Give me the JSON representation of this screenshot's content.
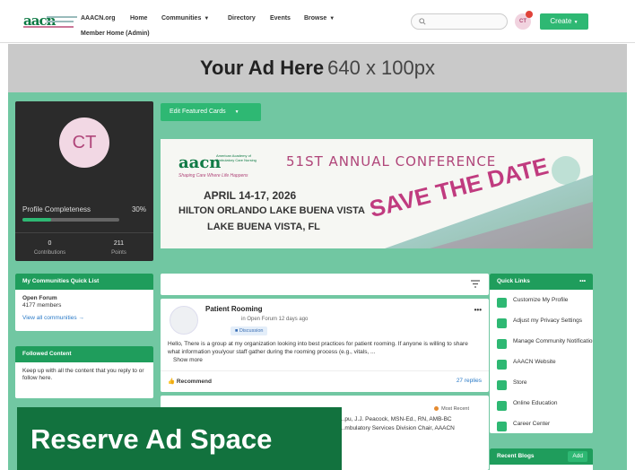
{
  "nav": {
    "logo_text": "aacn",
    "links": [
      "AAACN.org",
      "Home",
      "Communities",
      "Directory",
      "Events",
      "Browse"
    ],
    "second_row_link": "Member Home (Admin)",
    "search_placeholder": "",
    "avatar_initials": "CT",
    "create_label": "Create"
  },
  "ad_banner": {
    "title": "Your Ad Here",
    "size": "640 x 100px"
  },
  "profile": {
    "initials": "CT",
    "completeness_label": "Profile Completeness",
    "completeness_value": "30%",
    "completeness_fraction": 0.3,
    "contributions_count": "0",
    "contributions_label": "Contributions",
    "points_count": "211",
    "points_label": "Points"
  },
  "edit_featured_cards_label": "Edit Featured Cards",
  "conference": {
    "logo_text": "aacn",
    "logo_caption": "American Academy of Ambulatory Care Nursing",
    "tagline": "Shaping Care Where Life Happens",
    "title": "51ST ANNUAL CONFERENCE",
    "dates": "APRIL 14-17, 2026",
    "venue": "HILTON ORLANDO LAKE BUENA VISTA",
    "city": "LAKE BUENA VISTA, FL",
    "cta": "SAVE THE DATE"
  },
  "communities_card": {
    "header": "My Communities Quick List",
    "community_name": "Open Forum",
    "member_count": "4177 members",
    "view_all": "View all communities →"
  },
  "followed_card": {
    "header": "Followed Content",
    "body": "Keep up with all the content that you reply to or follow here."
  },
  "post": {
    "title": "Patient Rooming",
    "meta": "in Open Forum 12 days ago",
    "tag": "Discussion",
    "body": "Hello, There is a group at my organization looking into best practices for patient rooming. If anyone is willing to share what information you/your staff gather during the rooming process (e.g., vitals, ...",
    "show_more": "Show more",
    "recommend": "Recommend",
    "replies": "27 replies"
  },
  "post2": {
    "badge": "Most Recent",
    "line1": "...pu, J.J. Peacock, MSN-Ed., RN, AMB-BC",
    "line2": "...mbulatory Services Division Chair, AAACN"
  },
  "quick_links": {
    "header": "Quick Links",
    "items": [
      "Customize My Profile",
      "Adjust my Privacy Settings",
      "Manage Community Notifications",
      "AAACN Website",
      "Store",
      "Online Education",
      "Career Center"
    ]
  },
  "recent_blogs": {
    "header": "Recent Blogs",
    "add_label": "Add"
  },
  "reserve_ad": "Reserve Ad Space"
}
